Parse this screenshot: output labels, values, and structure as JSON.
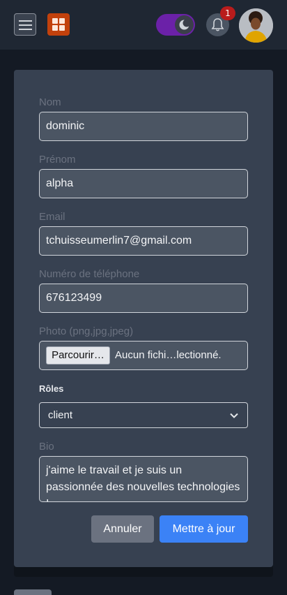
{
  "header": {
    "notification_count": "1",
    "theme_toggle_state": "dark",
    "colors": {
      "toggle": "#6b21a8",
      "logo": "#c2410c",
      "badge": "#b91c1c"
    }
  },
  "form": {
    "nom": {
      "label": "Nom",
      "value": "dominic"
    },
    "prenom": {
      "label": "Prénom",
      "value": "alpha"
    },
    "email": {
      "label": "Email",
      "value": "tchuisseumerlin7@gmail.com"
    },
    "telephone": {
      "label": "Numéro de téléphone",
      "value": "676123499"
    },
    "photo": {
      "label": "Photo (png,jpg,jpeg)",
      "browse_label": "Parcourir…",
      "status": "Aucun fichi…lectionné."
    },
    "roles": {
      "label": "Rôles",
      "selected": "client"
    },
    "bio": {
      "label": "Bio",
      "value": "j'aime le travail et je suis un passionnée des nouvelles technologies !"
    },
    "buttons": {
      "cancel": "Annuler",
      "update": "Mettre à jour"
    }
  }
}
